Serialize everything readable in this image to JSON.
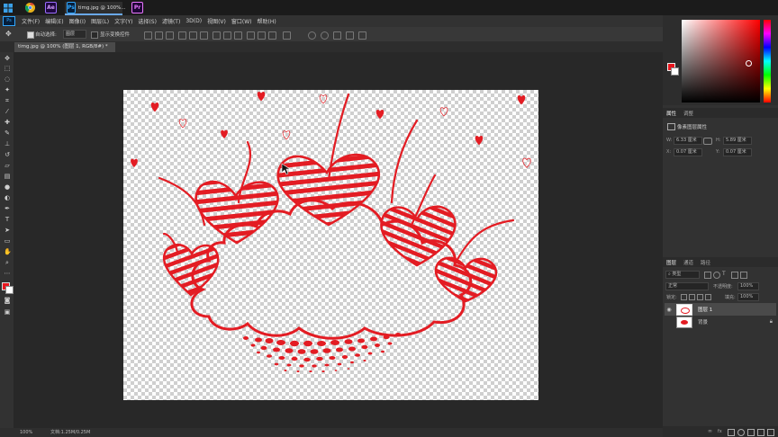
{
  "taskbar": {
    "apps": [
      {
        "icon": "windows-icon"
      },
      {
        "icon": "chrome-icon"
      },
      {
        "icon": "after-effects-icon",
        "label": "Ae"
      },
      {
        "icon": "photoshop-icon",
        "label": "Ps"
      },
      {
        "title": "timg.jpg @ 100%..."
      },
      {
        "icon": "premiere-icon",
        "label": "Pr"
      }
    ]
  },
  "menubar": {
    "logo": "Ps",
    "items": [
      "文件(F)",
      "编辑(E)",
      "图像(I)",
      "图层(L)",
      "文字(Y)",
      "选择(S)",
      "滤镜(T)",
      "3D(D)",
      "视图(V)",
      "窗口(W)",
      "帮助(H)"
    ]
  },
  "options": {
    "auto_select": "自动选择:",
    "auto_select_target": "图层",
    "show_transform": "显示变换控件"
  },
  "document": {
    "tab_title": "timg.jpg @ 100% (图层 1, RGB/8#) *"
  },
  "status": {
    "zoom": "100%",
    "doc_info": "文档:1.25M/0.25M"
  },
  "colors": {
    "foreground": "#e8161e",
    "background": "#ffffff",
    "artwork": "#e31c23"
  },
  "properties": {
    "tabs": [
      "属性",
      "调整"
    ],
    "title": "像素图层属性",
    "w_label": "W:",
    "w_value": "6.33 厘米",
    "h_label": "H:",
    "h_value": "5.89 厘米",
    "x_label": "X:",
    "x_value": "0.07 厘米",
    "y_label": "Y:",
    "y_value": "0.07 厘米"
  },
  "layers_panel": {
    "tabs": [
      "图层",
      "通道",
      "路径"
    ],
    "filter_kind": "类型",
    "blend_mode": "正常",
    "opacity_label": "不透明度:",
    "opacity_value": "100%",
    "lock_label": "锁定:",
    "fill_label": "填充:",
    "fill_value": "100%",
    "layers": [
      {
        "name": "图层 1",
        "selected": true
      },
      {
        "name": "背景",
        "selected": false
      }
    ]
  }
}
